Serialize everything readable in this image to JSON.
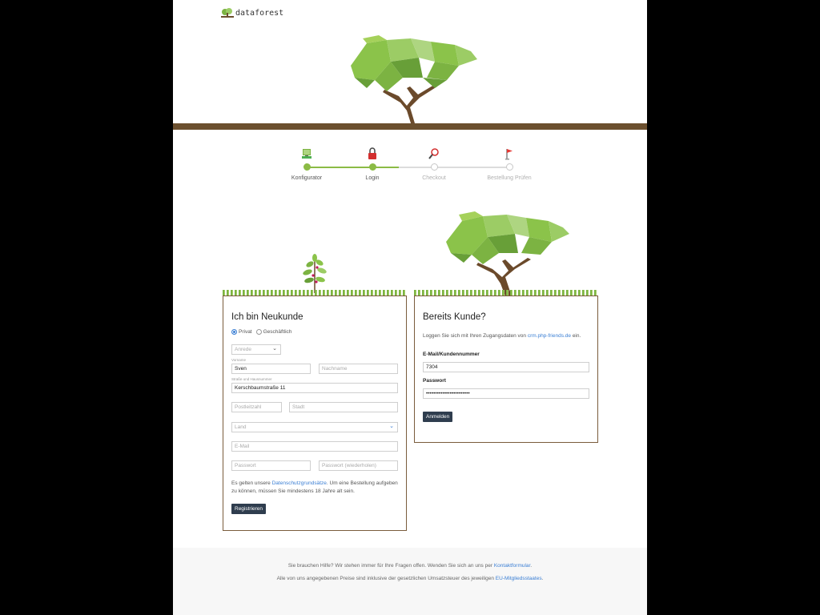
{
  "brand": {
    "name": "dataforest"
  },
  "steps": [
    {
      "label": "Konfigurator",
      "icon": "computer-icon",
      "state": "done"
    },
    {
      "label": "Login",
      "icon": "lock-icon",
      "state": "active"
    },
    {
      "label": "Checkout",
      "icon": "magnifier-icon",
      "state": "todo"
    },
    {
      "label": "Bestellung Prüfen",
      "icon": "flag-icon",
      "state": "todo"
    }
  ],
  "register": {
    "title": "Ich bin Neukunde",
    "radio_private": "Privat",
    "radio_business": "Geschäftlich",
    "salutation_placeholder": "Anrede",
    "firstname_label": "Vorname",
    "firstname_value": "Sven",
    "lastname_placeholder": "Nachname",
    "street_label": "Straße und Hausnummer",
    "street_value": "Kerschbaumstraße 11",
    "zip_placeholder": "Postleitzahl",
    "city_placeholder": "Stadt",
    "country_placeholder": "Land",
    "email_placeholder": "E-Mail",
    "password_placeholder": "Passwort",
    "password_repeat_placeholder": "Passwort (wiederholen)",
    "terms_prefix": "Es gelten unsere ",
    "terms_link": "Datenschutzgrundsätze",
    "terms_suffix": ". Um eine Bestellung aufgeben",
    "terms_line2": "zu können, müssen Sie mindestens 18 Jahre alt sein.",
    "submit": "Registrieren"
  },
  "login": {
    "title": "Bereits Kunde?",
    "intro_prefix": "Loggen Sie sich mit Ihren Zugangsdaten von ",
    "intro_link": "crm.php-friends.de",
    "intro_suffix": " ein.",
    "email_label": "E-Mail/Kundennummer",
    "email_value": "7304",
    "password_label": "Passwort",
    "password_value": "••••••••••••••••••••••••",
    "submit": "Anmelden"
  },
  "footer": {
    "help_prefix": "Sie brauchen Hilfe? Wir stehen immer für Ihre Fragen offen. Wenden Sie sich an uns per ",
    "help_link": "Kontaktformular",
    "help_suffix": ".",
    "vat_prefix": "Alle von uns angegebenen Preise sind inklusive der gesetzlichen Umsatzsteuer des jeweiligen ",
    "vat_link": "EU-Mitgliedsstaates",
    "vat_suffix": "."
  },
  "colors": {
    "accent_green": "#8bbb45",
    "ground_brown": "#6b4f2e",
    "button": "#2f3d4e",
    "link": "#3b7fd4"
  }
}
